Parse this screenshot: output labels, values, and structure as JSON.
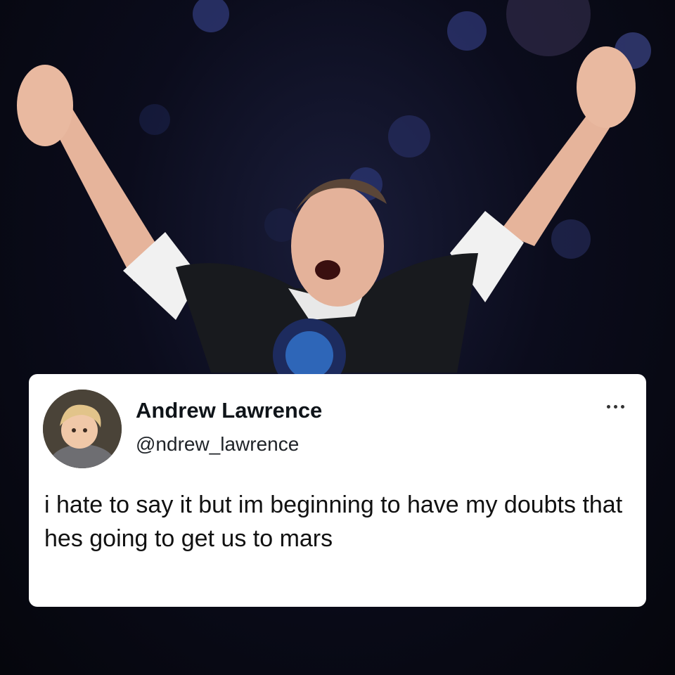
{
  "post": {
    "author_name": "Andrew Lawrence",
    "author_handle": "@ndrew_lawrence",
    "text": "i hate to say it but im beginning to have my doubts that hes going to get us to mars",
    "more_icon": "more-horizontal-icon"
  },
  "photo": {
    "description_icon": "photo-background"
  }
}
